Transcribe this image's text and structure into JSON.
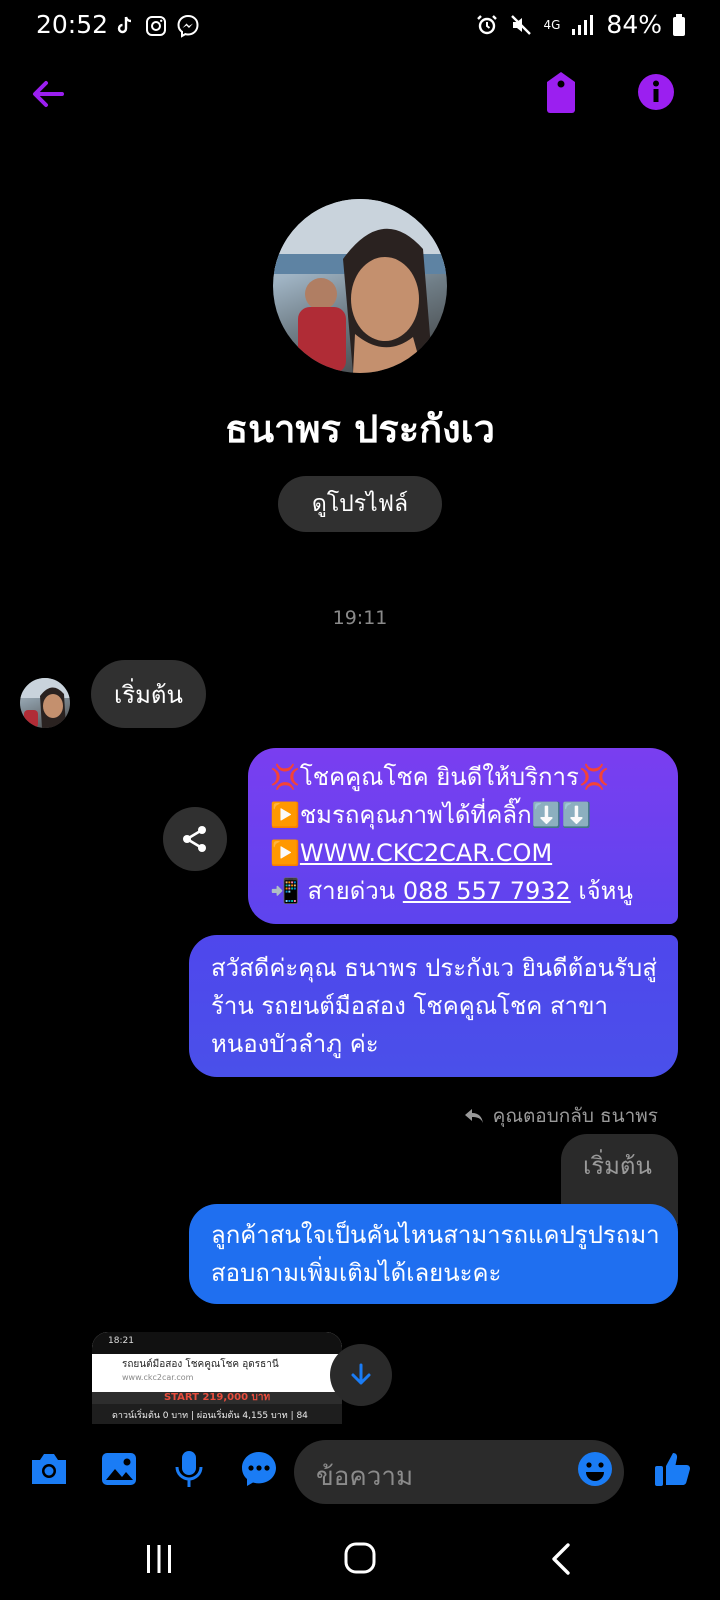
{
  "status_bar": {
    "time": "20:52",
    "battery": "84%",
    "network": "4G",
    "left_icons": [
      "tiktok-icon",
      "instagram-icon",
      "messenger-icon"
    ],
    "right_icons": [
      "alarm-icon",
      "mute-icon",
      "signal-icon",
      "battery-icon"
    ]
  },
  "header": {
    "back_icon": "arrow-left-icon",
    "tag_icon": "tag-icon",
    "info_icon": "info-icon",
    "accent_color": "#9b1ff0"
  },
  "profile": {
    "name": "ธนาพร ประกังเว",
    "view_profile_label": "ดูโปรไฟล์"
  },
  "conversation": {
    "timestamp": "19:11",
    "incoming": {
      "text": "เริ่มต้น"
    },
    "outgoing": [
      {
        "lines": [
          {
            "prefix": "💢",
            "text": "โชคคูณโชค ยินดีให้บริการ",
            "suffix": "💢"
          },
          {
            "prefix": "▶️",
            "text": "ชมรถคุณภาพได้ที่คลิ๊ก",
            "suffix": "⬇️⬇️"
          },
          {
            "prefix": "▶️",
            "text": "WWW.CKC2CAR.COM"
          },
          {
            "prefix": "📲",
            "text_before": " สายด่วน ",
            "phone": "088 557 7932",
            "text_after": " เจ้หนู"
          }
        ]
      },
      {
        "text": "สวัสดีค่ะคุณ ธนาพร ประกังเว ยินดีต้อนรับสู่ร้าน รถยนต์มือสอง โชคคูณโชค สาขาหนองบัวลำภู ค่ะ"
      },
      {
        "text": "ลูกค้าสนใจเป็นคันไหนสามารถแคปรูปรถมาสอบถามเพิ่มเติมได้เลยนะคะ"
      }
    ],
    "reply_label": "คุณตอบกลับ ธนาพร",
    "quoted_text": "เริ่มต้น",
    "attachment": {
      "time": "18:21",
      "title": "รถยนต์มือสอง โชคคูณโชค อุดรธานี",
      "url": "www.ckc2car.com",
      "price_text": "START 219,000 บาท",
      "line": "ดาวน์เริ่มต้น 0 บาท | ผ่อนเริ่มต้น 4,155 บาท | 84"
    }
  },
  "composer": {
    "placeholder": "ข้อความ",
    "accent_color": "#1a7cf5",
    "icons": [
      "camera-icon",
      "gallery-icon",
      "mic-icon",
      "chat-bubble-icon",
      "emoji-icon",
      "like-icon"
    ]
  },
  "nav": {
    "icons": [
      "recents-icon",
      "home-icon",
      "back-icon"
    ]
  }
}
